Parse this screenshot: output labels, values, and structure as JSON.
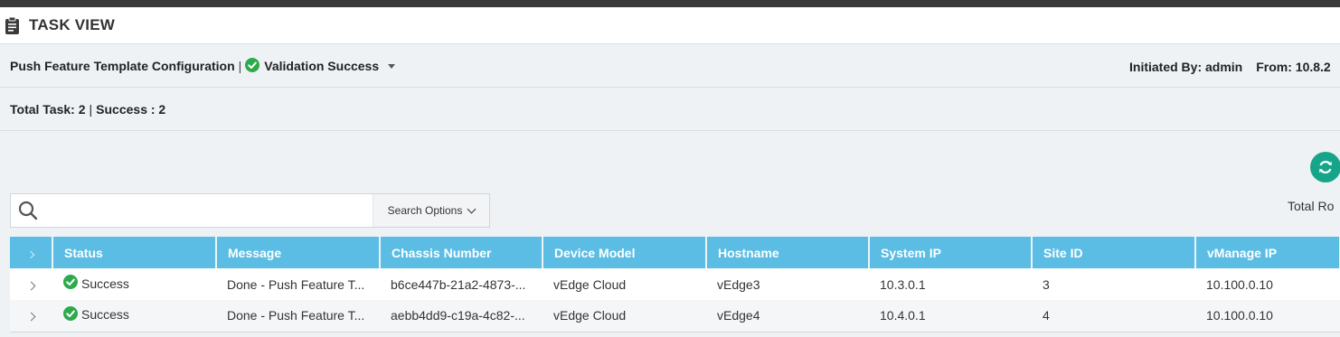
{
  "header": {
    "title": "TASK VIEW",
    "icon": "clipboard-icon"
  },
  "task": {
    "name": "Push Feature Template Configuration",
    "separator": "|",
    "validation": "Validation Success",
    "initiated_by": "Initiated By: admin",
    "from": "From: 10.8.2"
  },
  "summary": {
    "total": "Total Task: 2",
    "separator": "|",
    "success": "Success : 2"
  },
  "toolbar": {
    "total_rows": "Total Ro"
  },
  "search": {
    "value": "",
    "placeholder": "",
    "options_label": "Search Options"
  },
  "table": {
    "columns": [
      "Status",
      "Message",
      "Chassis Number",
      "Device Model",
      "Hostname",
      "System IP",
      "Site ID",
      "vManage IP"
    ],
    "rows": [
      [
        "Success",
        "Done - Push Feature T...",
        "b6ce447b-21a2-4873-...",
        "vEdge Cloud",
        "vEdge3",
        "10.3.0.1",
        "3",
        "10.100.0.10"
      ],
      [
        "Success",
        "Done - Push Feature T...",
        "aebb4dd9-c19a-4c82-...",
        "vEdge Cloud",
        "vEdge4",
        "10.4.0.1",
        "4",
        "10.100.0.10"
      ]
    ]
  },
  "colors": {
    "header_row": "#5bbde4",
    "success": "#2eaa4c",
    "refresh": "#17a589"
  }
}
